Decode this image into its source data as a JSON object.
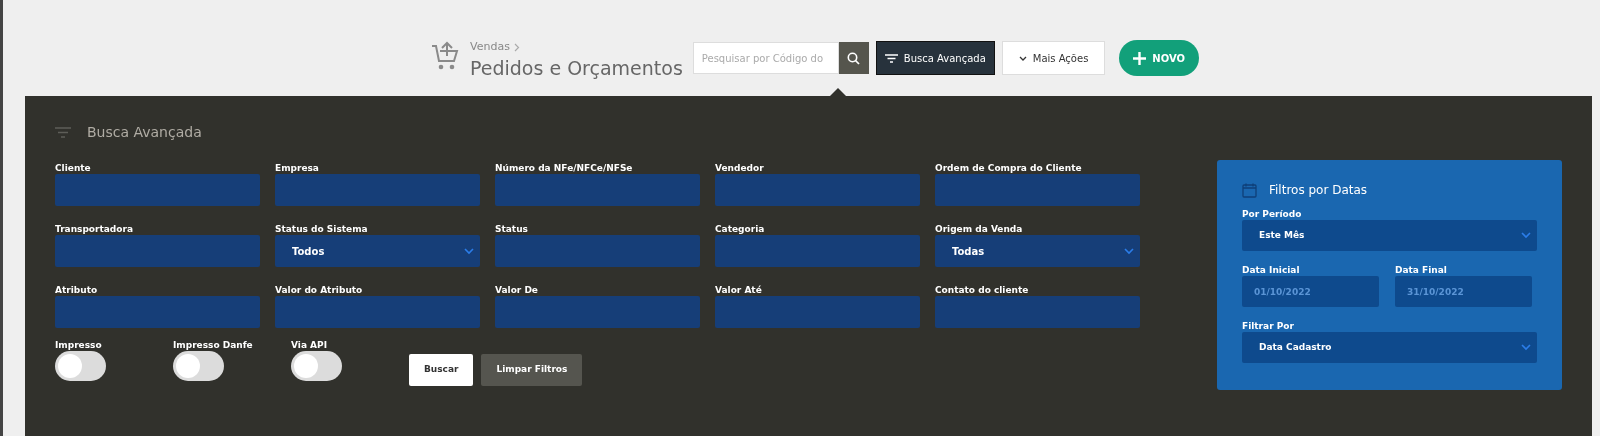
{
  "header": {
    "breadcrumb": "Vendas",
    "title": "Pedidos e Orçamentos",
    "search": {
      "placeholder": "Pesquisar por Código do"
    },
    "buttons": [
      {
        "kind": "dark",
        "label": "Busca Avançada",
        "selected": true
      },
      {
        "kind": "light",
        "label": "Mais Ações",
        "selected": false
      },
      {
        "kind": "primary",
        "label": "NOVO",
        "selected": false
      }
    ]
  },
  "advanced_search": {
    "title": "Busca Avançada",
    "fields": [
      {
        "kind": "text",
        "label": "Cliente"
      },
      {
        "kind": "text",
        "label": "Empresa"
      },
      {
        "kind": "text",
        "label": "Número da NFe/NFCe/NFSe"
      },
      {
        "kind": "text",
        "label": "Vendedor"
      },
      {
        "kind": "text",
        "label": "Ordem de Compra do Cliente"
      },
      {
        "kind": "text",
        "label": "Transportadora"
      },
      {
        "kind": "select",
        "label": "Status do Sistema",
        "value": "Todos"
      },
      {
        "kind": "text",
        "label": "Status"
      },
      {
        "kind": "text",
        "label": "Categoria"
      },
      {
        "kind": "select",
        "label": "Origem da Venda",
        "value": "Todas"
      },
      {
        "kind": "text",
        "label": "Atributo"
      },
      {
        "kind": "text",
        "label": "Valor do Atributo"
      },
      {
        "kind": "text",
        "label": "Valor De"
      },
      {
        "kind": "text",
        "label": "Valor Até"
      },
      {
        "kind": "text",
        "label": "Contato do cliente"
      }
    ],
    "toggles": [
      {
        "label": "Impresso",
        "on": false
      },
      {
        "label": "Impresso Danfe",
        "on": false
      },
      {
        "label": "Via API",
        "on": false
      }
    ],
    "actions": [
      {
        "kind": "primary",
        "label": "Buscar"
      },
      {
        "kind": "secondary",
        "label": "Limpar Filtros"
      }
    ],
    "date_filters": {
      "title": "Filtros por Datas",
      "period": {
        "label": "Por Período",
        "value": "Este Mês"
      },
      "start": {
        "label": "Data Inicial",
        "placeholder": "01/10/2022"
      },
      "end": {
        "label": "Data Final",
        "placeholder": "31/10/2022"
      },
      "filter_by": {
        "label": "Filtrar Por",
        "value": "Data Cadastro"
      }
    }
  }
}
